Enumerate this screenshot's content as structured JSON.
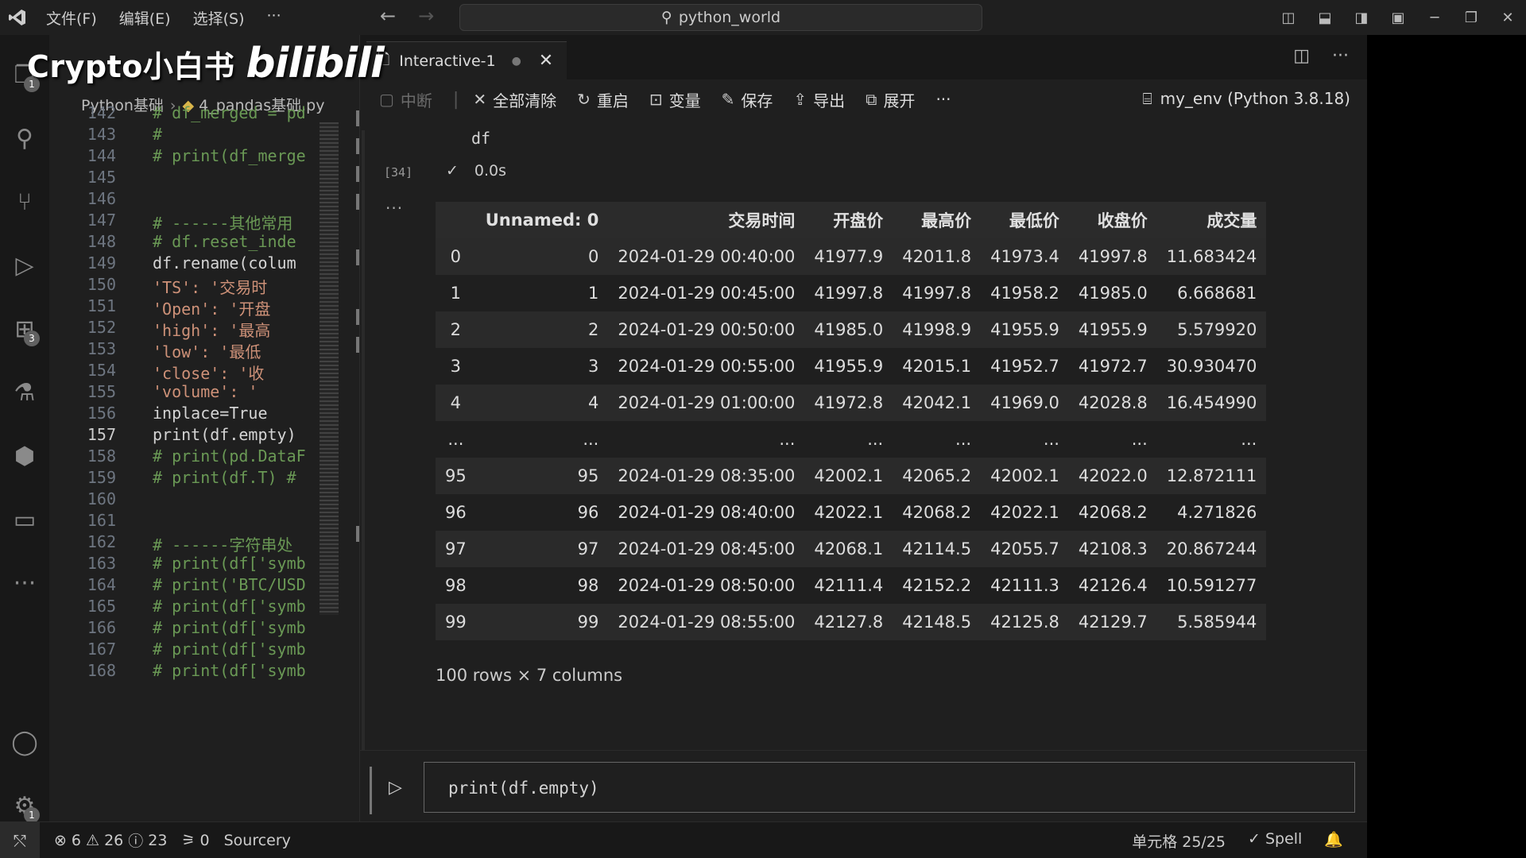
{
  "titlebar": {
    "menu": [
      "文件(F)",
      "编辑(E)",
      "选择(S)",
      "···"
    ],
    "search": "python_world"
  },
  "watermark": {
    "channel": "Crypto小白书",
    "site": "bilibili"
  },
  "activity": {
    "explorer_badge": "1",
    "extensions_badge": "3",
    "settings_badge": "1"
  },
  "breadcrumb": {
    "folder": "Python基础",
    "file": "4_pandas基础.py"
  },
  "code": [
    {
      "n": "142",
      "t": "# df_merged = pd",
      "k": "cm"
    },
    {
      "n": "143",
      "t": "#",
      "k": "cm"
    },
    {
      "n": "144",
      "t": "# print(df_merge",
      "k": "cm"
    },
    {
      "n": "145",
      "t": "",
      "k": "plain"
    },
    {
      "n": "146",
      "t": "",
      "k": "plain"
    },
    {
      "n": "147",
      "t": "# ------其他常用",
      "k": "cm"
    },
    {
      "n": "148",
      "t": "# df.reset_inde",
      "k": "cm"
    },
    {
      "n": "149",
      "t": "df.rename(colum",
      "k": "plain"
    },
    {
      "n": "150",
      "t": "    'TS': '交易时",
      "k": "str"
    },
    {
      "n": "151",
      "t": "    'Open': '开盘",
      "k": "str"
    },
    {
      "n": "152",
      "t": "    'high': '最高",
      "k": "str"
    },
    {
      "n": "153",
      "t": "    'low': '最低",
      "k": "str"
    },
    {
      "n": "154",
      "t": "    'close': '收",
      "k": "str"
    },
    {
      "n": "155",
      "t": "    'volume': '",
      "k": "str"
    },
    {
      "n": "156",
      "t": "  inplace=True",
      "k": "plain"
    },
    {
      "n": "157",
      "t": "print(df.empty)",
      "k": "plain"
    },
    {
      "n": "158",
      "t": "# print(pd.DataF",
      "k": "cm"
    },
    {
      "n": "159",
      "t": "# print(df.T)  #",
      "k": "cm"
    },
    {
      "n": "160",
      "t": "",
      "k": "plain"
    },
    {
      "n": "161",
      "t": "",
      "k": "plain"
    },
    {
      "n": "162",
      "t": "# ------字符串处",
      "k": "cm"
    },
    {
      "n": "163",
      "t": "# print(df['symb",
      "k": "cm"
    },
    {
      "n": "164",
      "t": "# print('BTC/USD",
      "k": "cm"
    },
    {
      "n": "165",
      "t": "# print(df['symb",
      "k": "cm"
    },
    {
      "n": "166",
      "t": "# print(df['symb",
      "k": "cm"
    },
    {
      "n": "167",
      "t": "# print(df['symb",
      "k": "cm"
    },
    {
      "n": "168",
      "t": "# print(df['symb",
      "k": "cm"
    }
  ],
  "active_line": "157",
  "tab": {
    "title": "Interactive-1"
  },
  "toolbar": {
    "interrupt": "中断",
    "clear_all": "全部清除",
    "restart": "重启",
    "variables": "变量",
    "save": "保存",
    "export": "导出",
    "expand": "展开",
    "more": "···",
    "kernel": "my_env (Python 3.8.18)"
  },
  "cell": {
    "code": "df",
    "exec_count": "[34]",
    "status_check": "✓",
    "duration": "0.0s",
    "output_more": "···"
  },
  "dataframe": {
    "columns": [
      "",
      "Unnamed: 0",
      "交易时间",
      "开盘价",
      "最高价",
      "最低价",
      "收盘价",
      "成交量"
    ],
    "rows": [
      [
        "0",
        "0",
        "2024-01-29 00:40:00",
        "41977.9",
        "42011.8",
        "41973.4",
        "41997.8",
        "11.683424"
      ],
      [
        "1",
        "1",
        "2024-01-29 00:45:00",
        "41997.8",
        "41997.8",
        "41958.2",
        "41985.0",
        "6.668681"
      ],
      [
        "2",
        "2",
        "2024-01-29 00:50:00",
        "41985.0",
        "41998.9",
        "41955.9",
        "41955.9",
        "5.579920"
      ],
      [
        "3",
        "3",
        "2024-01-29 00:55:00",
        "41955.9",
        "42015.1",
        "41952.7",
        "41972.7",
        "30.930470"
      ],
      [
        "4",
        "4",
        "2024-01-29 01:00:00",
        "41972.8",
        "42042.1",
        "41969.0",
        "42028.8",
        "16.454990"
      ],
      [
        "...",
        "...",
        "...",
        "...",
        "...",
        "...",
        "...",
        "..."
      ],
      [
        "95",
        "95",
        "2024-01-29 08:35:00",
        "42002.1",
        "42065.2",
        "42002.1",
        "42022.0",
        "12.872111"
      ],
      [
        "96",
        "96",
        "2024-01-29 08:40:00",
        "42022.1",
        "42068.2",
        "42022.1",
        "42068.2",
        "4.271826"
      ],
      [
        "97",
        "97",
        "2024-01-29 08:45:00",
        "42068.1",
        "42114.5",
        "42055.7",
        "42108.3",
        "20.867244"
      ],
      [
        "98",
        "98",
        "2024-01-29 08:50:00",
        "42111.4",
        "42152.2",
        "42111.3",
        "42126.4",
        "10.591277"
      ],
      [
        "99",
        "99",
        "2024-01-29 08:55:00",
        "42127.8",
        "42148.5",
        "42125.8",
        "42129.7",
        "5.585944"
      ]
    ],
    "shape": "100 rows × 7 columns"
  },
  "input": {
    "code": "print(df.empty)"
  },
  "status": {
    "errors": "6",
    "warnings": "26",
    "infos": "23",
    "ports": "0",
    "sourcery": "Sourcery",
    "cell_pos": "单元格 25/25",
    "spell": "Spell"
  }
}
